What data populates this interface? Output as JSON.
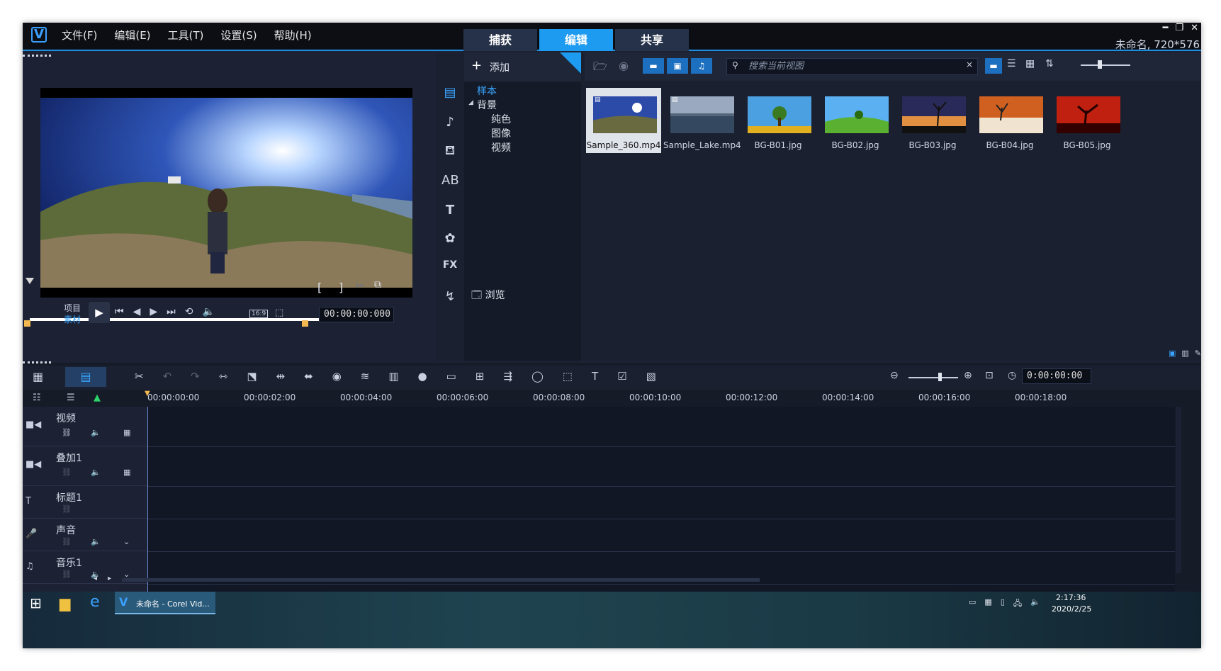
{
  "window": {
    "project_info": "未命名, 720*576"
  },
  "menu": [
    "文件(F)",
    "编辑(E)",
    "工具(T)",
    "设置(S)",
    "帮助(H)"
  ],
  "tabs": [
    {
      "label": "捕获"
    },
    {
      "label": "编辑"
    },
    {
      "label": "共享"
    }
  ],
  "player": {
    "mode_project": "项目",
    "mode_clip": "素材",
    "timecode": "00:00:00:000",
    "aspect": "16:9"
  },
  "library": {
    "add_label": "添加",
    "search_placeholder": "搜索当前视图",
    "tree": {
      "sample": "样本",
      "background": "背景",
      "children": [
        "纯色",
        "图像",
        "视频"
      ]
    },
    "browse_label": "浏览",
    "items": [
      {
        "name": "Sample_360.mp4",
        "selected": true
      },
      {
        "name": "Sample_Lake.mp4"
      },
      {
        "name": "BG-B01.jpg"
      },
      {
        "name": "BG-B02.jpg"
      },
      {
        "name": "BG-B03.jpg"
      },
      {
        "name": "BG-B04.jpg"
      },
      {
        "name": "BG-B05.jpg"
      }
    ]
  },
  "timeline": {
    "timecode": "0:00:00:00",
    "ruler": [
      "00:00:00:00",
      "00:00:02:00",
      "00:00:04:00",
      "00:00:06:00",
      "00:00:08:00",
      "00:00:10:00",
      "00:00:12:00",
      "00:00:14:00",
      "00:00:16:00",
      "00:00:18:00"
    ],
    "tracks": [
      "视频",
      "叠加1",
      "标题1",
      "声音",
      "音乐1"
    ]
  },
  "taskbar": {
    "app_label": "未命名 - Corel Vid...",
    "time": "2:17:36",
    "date": "2020/2/25"
  },
  "colors": {
    "accent": "#1d9bf0",
    "scrub_handle": "#f2b950"
  }
}
